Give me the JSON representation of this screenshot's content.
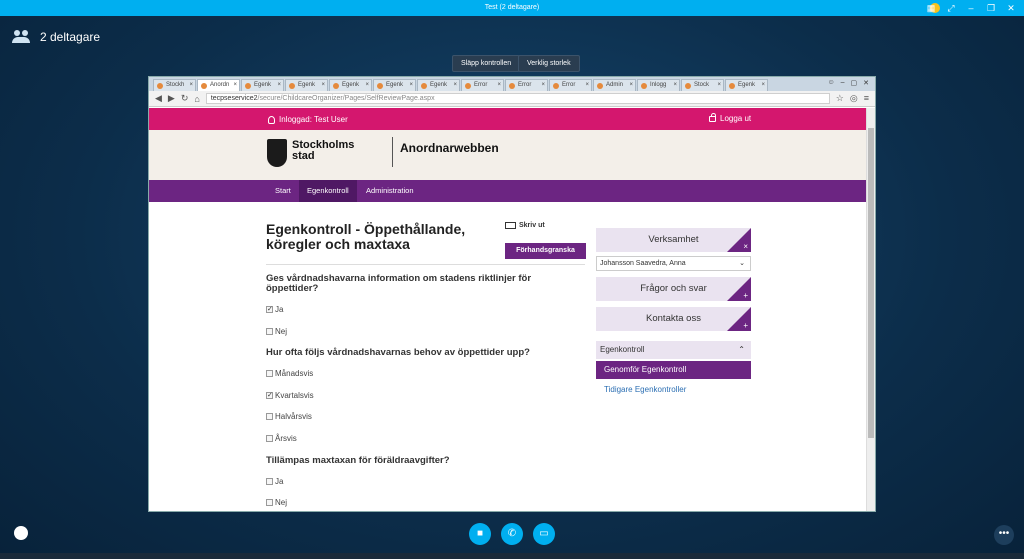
{
  "skype": {
    "window_title": "Test (2 deltagare)",
    "participants_label": "2 deltagare",
    "release_control": "Släpp kontrollen",
    "actual_size": "Verklig storlek"
  },
  "browser": {
    "tabs": [
      {
        "label": "Stockh",
        "active": false
      },
      {
        "label": "Anordn",
        "active": true
      },
      {
        "label": "Egenk",
        "active": false
      },
      {
        "label": "Egenk",
        "active": false
      },
      {
        "label": "Egenk",
        "active": false
      },
      {
        "label": "Egenk",
        "active": false
      },
      {
        "label": "Egenk",
        "active": false
      },
      {
        "label": "Error",
        "active": false
      },
      {
        "label": "Error",
        "active": false
      },
      {
        "label": "Error",
        "active": false
      },
      {
        "label": "Admin",
        "active": false
      },
      {
        "label": "Inlogg",
        "active": false
      },
      {
        "label": "Stock",
        "active": false
      },
      {
        "label": "Egenk",
        "active": false
      }
    ],
    "url_host": "tecpseservice2",
    "url_path": "/secure/ChildcareOrganizer/Pages/SelfReviewPage.aspx"
  },
  "site": {
    "logged_in": "Inloggad: Test User",
    "logout": "Logga ut",
    "brand_line1": "Stockholms",
    "brand_line2": "stad",
    "app_name": "Anordnarwebben",
    "nav": [
      "Start",
      "Egenkontroll",
      "Administration"
    ]
  },
  "form": {
    "title": "Egenkontroll - Öppethållande, köregler och maxtaxa",
    "print": "Skriv ut",
    "preview": "Förhandsgranska",
    "questions": [
      {
        "text": "Ges vårdnadshavarna information om stadens riktlinjer för öppettider?",
        "options": [
          {
            "label": "Ja",
            "checked": true
          },
          {
            "label": "Nej",
            "checked": false
          }
        ]
      },
      {
        "text": "Hur ofta följs vårdnadshavarnas behov av öppettider upp?",
        "options": [
          {
            "label": "Månadsvis",
            "checked": false
          },
          {
            "label": "Kvartalsvis",
            "checked": true
          },
          {
            "label": "Halvårsvis",
            "checked": false
          },
          {
            "label": "Årsvis",
            "checked": false
          }
        ]
      },
      {
        "text": "Tillämpas maxtaxan för föräldraavgifter?",
        "options": [
          {
            "label": "Ja",
            "checked": false
          },
          {
            "label": "Nej",
            "checked": false
          }
        ]
      }
    ]
  },
  "sidebar": {
    "verksamhet": "Verksamhet",
    "verksamhet_selected": "Johansson Saavedra, Anna",
    "questions": "Frågor och svar",
    "contact": "Kontakta oss",
    "egenkontroll": "Egenkontroll",
    "perform": "Genomför Egenkontroll",
    "previous": "Tidigare Egenkontroller"
  }
}
